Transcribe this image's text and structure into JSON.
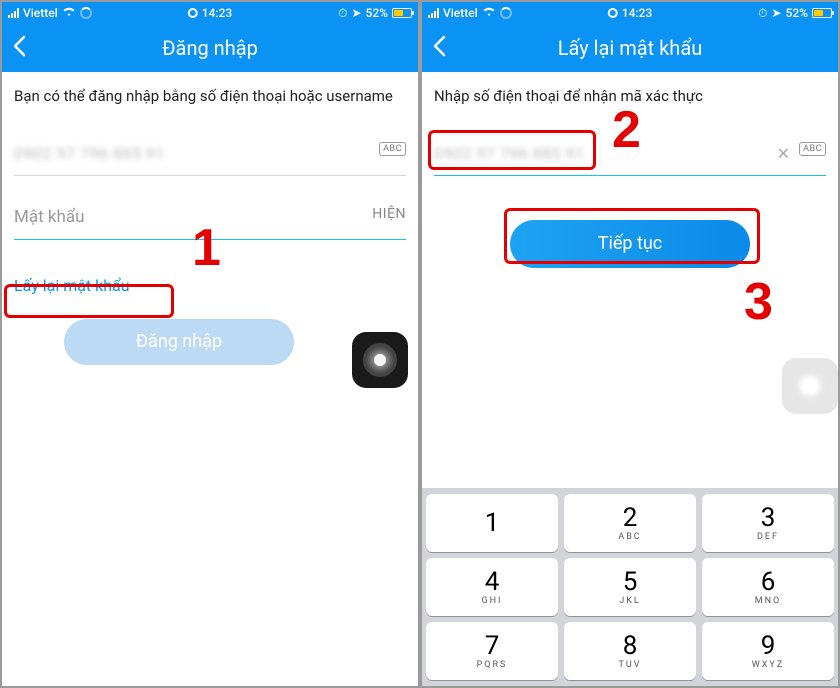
{
  "status": {
    "carrier": "Viettel",
    "time": "14:23",
    "battery": "52%"
  },
  "left": {
    "title": "Đăng nhập",
    "instruction": "Bạn có thể đăng nhập bằng số điện thoại hoặc username",
    "phone_blur": "0902 97 796 885 91",
    "abc": "ABC",
    "password_placeholder": "Mật khẩu",
    "show_label": "HIỆN",
    "forgot": "Lấy lại mật khẩu",
    "login_btn": "Đăng nhập",
    "annot1": "1"
  },
  "right": {
    "title": "Lấy lại mật khẩu",
    "instruction": "Nhập số điện thoại để nhận mã xác thực",
    "phone_blur": "0902 97 796 885 91",
    "abc": "ABC",
    "continue_btn": "Tiếp tục",
    "annot2": "2",
    "annot3": "3"
  },
  "keypad": {
    "keys": [
      {
        "n": "1",
        "s": ""
      },
      {
        "n": "2",
        "s": "ABC"
      },
      {
        "n": "3",
        "s": "DEF"
      },
      {
        "n": "4",
        "s": "GHI"
      },
      {
        "n": "5",
        "s": "JKL"
      },
      {
        "n": "6",
        "s": "MNO"
      },
      {
        "n": "7",
        "s": "PQRS"
      },
      {
        "n": "8",
        "s": "TUV"
      },
      {
        "n": "9",
        "s": "WXYZ"
      }
    ]
  }
}
